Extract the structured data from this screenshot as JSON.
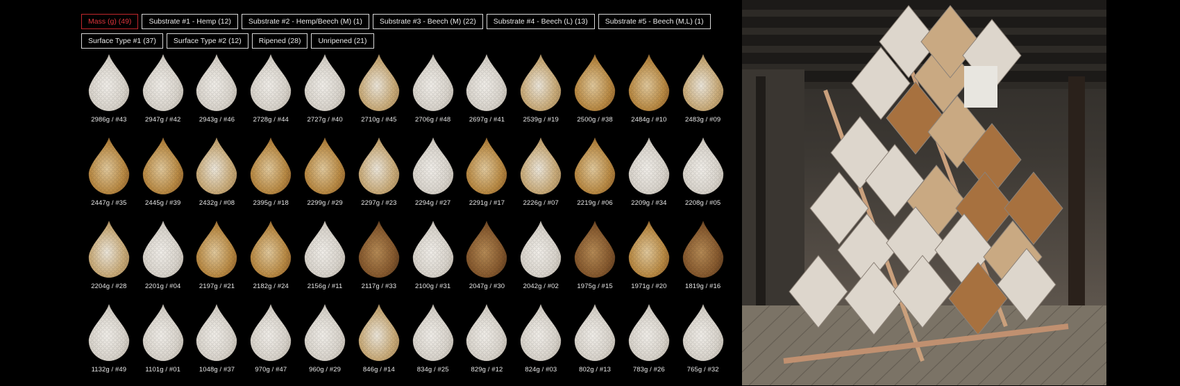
{
  "filters": {
    "row1": [
      {
        "label": "Mass (g) (49)",
        "active": true
      },
      {
        "label": "Substrate #1 - Hemp (12)",
        "active": false
      },
      {
        "label": "Substrate #2 - Hemp/Beech (M) (1)",
        "active": false
      },
      {
        "label": "Substrate #3 - Beech (M) (22)",
        "active": false
      },
      {
        "label": "Substrate #4 - Beech (L) (13)",
        "active": false
      },
      {
        "label": "Substrate #5 - Beech (M,L) (1)",
        "active": false
      }
    ],
    "row2": [
      {
        "label": "Surface Type #1 (37)",
        "active": false
      },
      {
        "label": "Surface Type #2 (12)",
        "active": false
      },
      {
        "label": "Ripened (28)",
        "active": false
      },
      {
        "label": "Unripened (21)",
        "active": false
      }
    ]
  },
  "samples": [
    {
      "caption": "2986g / #43",
      "tone": "white"
    },
    {
      "caption": "2947g / #42",
      "tone": "white"
    },
    {
      "caption": "2943g / #46",
      "tone": "white"
    },
    {
      "caption": "2728g / #44",
      "tone": "white"
    },
    {
      "caption": "2727g / #40",
      "tone": "white"
    },
    {
      "caption": "2710g / #45",
      "tone": "mixed"
    },
    {
      "caption": "2706g / #48",
      "tone": "white"
    },
    {
      "caption": "2697g / #41",
      "tone": "white"
    },
    {
      "caption": "2539g / #19",
      "tone": "mixed"
    },
    {
      "caption": "2500g / #38",
      "tone": "rust"
    },
    {
      "caption": "2484g / #10",
      "tone": "rust"
    },
    {
      "caption": "2483g / #09",
      "tone": "mixed"
    },
    {
      "caption": "2447g / #35",
      "tone": "rust"
    },
    {
      "caption": "2445g / #39",
      "tone": "rust"
    },
    {
      "caption": "2432g / #08",
      "tone": "mixed"
    },
    {
      "caption": "2395g / #18",
      "tone": "rust"
    },
    {
      "caption": "2299g / #29",
      "tone": "rust"
    },
    {
      "caption": "2297g / #23",
      "tone": "mixed"
    },
    {
      "caption": "2294g / #27",
      "tone": "white"
    },
    {
      "caption": "2291g / #17",
      "tone": "rust"
    },
    {
      "caption": "2226g / #07",
      "tone": "mixed"
    },
    {
      "caption": "2219g / #06",
      "tone": "rust"
    },
    {
      "caption": "2209g / #34",
      "tone": "white"
    },
    {
      "caption": "2208g / #05",
      "tone": "white"
    },
    {
      "caption": "2204g / #28",
      "tone": "mixed"
    },
    {
      "caption": "2201g / #04",
      "tone": "white"
    },
    {
      "caption": "2197g / #21",
      "tone": "rust"
    },
    {
      "caption": "2182g / #24",
      "tone": "rust"
    },
    {
      "caption": "2156g / #11",
      "tone": "white"
    },
    {
      "caption": "2117g / #33",
      "tone": "dark"
    },
    {
      "caption": "2100g / #31",
      "tone": "white"
    },
    {
      "caption": "2047g / #30",
      "tone": "dark"
    },
    {
      "caption": "2042g / #02",
      "tone": "white"
    },
    {
      "caption": "1975g / #15",
      "tone": "dark"
    },
    {
      "caption": "1971g / #20",
      "tone": "rust"
    },
    {
      "caption": "1819g / #16",
      "tone": "dark"
    },
    {
      "caption": "1132g / #49",
      "tone": "white"
    },
    {
      "caption": "1101g / #01",
      "tone": "white"
    },
    {
      "caption": "1048g / #37",
      "tone": "white"
    },
    {
      "caption": "970g / #47",
      "tone": "white"
    },
    {
      "caption": "960g / #29",
      "tone": "white"
    },
    {
      "caption": "846g / #14",
      "tone": "mixed"
    },
    {
      "caption": "834g / #25",
      "tone": "white"
    },
    {
      "caption": "829g / #12",
      "tone": "white"
    },
    {
      "caption": "824g / #03",
      "tone": "white"
    },
    {
      "caption": "802g / #13",
      "tone": "white"
    },
    {
      "caption": "783g / #26",
      "tone": "white"
    },
    {
      "caption": "765g / #32",
      "tone": "white"
    }
  ],
  "colors": {
    "active_border": "#c2272d",
    "active_text": "#e0353c",
    "inactive_border": "#d9d9d9",
    "tile_white": "#e6e2dc",
    "tile_rust": "#b07a3a",
    "tile_dark": "#6e4a2a",
    "wood": "#caa07c"
  }
}
